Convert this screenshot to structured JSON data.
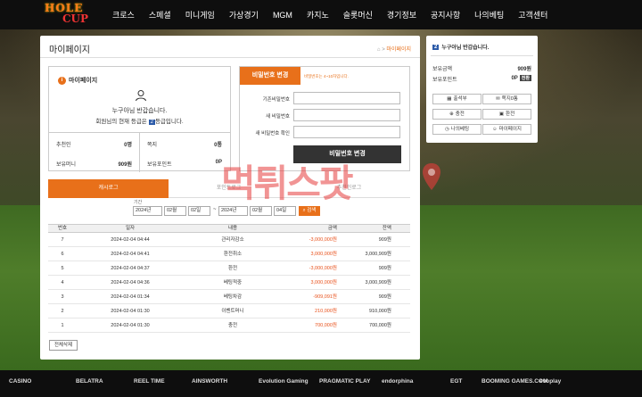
{
  "logo": {
    "line1": "HOLE",
    "line2": "CUP"
  },
  "nav": [
    "크로스",
    "스페셜",
    "미니게임",
    "가상경기",
    "MGM",
    "카지노",
    "슬롯머신",
    "경기정보",
    "공지사항",
    "나의베팅",
    "고객센터"
  ],
  "page": {
    "title": "마이페이지",
    "breadcrumb_sep": ">",
    "breadcrumb_current": "마이페이지"
  },
  "mypage": {
    "header": "마이페이지",
    "greeting": "누구아님 반갑습니다.",
    "level_text": "회원님의 현재 등급은",
    "level": "2",
    "level_suffix": "등급입니다.",
    "stats": [
      {
        "label": "추천인",
        "value": "0명"
      },
      {
        "label": "쪽지",
        "value": "0통"
      },
      {
        "label": "보유머니",
        "value": "909원"
      },
      {
        "label": "보유포인트",
        "value": "0P"
      }
    ]
  },
  "password": {
    "tab": "비밀번호 변경",
    "note": "비밀번호는 4~10자입니다.",
    "fields": [
      "기존비밀번호",
      "새 비밀번호",
      "새 비밀번호 확인"
    ],
    "submit": "비밀번호 변경"
  },
  "tabs": [
    "캐시로그",
    "포인트로그",
    "추천인로그"
  ],
  "search": {
    "label": "기간",
    "from_year": "2024년",
    "from_month": "02월",
    "from_day": "02일",
    "to_sep": "~",
    "to_year": "2024년",
    "to_month": "02월",
    "to_day": "04일",
    "button": "검색"
  },
  "table": {
    "headers": [
      "번호",
      "일자",
      "내용",
      "금액",
      "잔액"
    ],
    "rows": [
      [
        "7",
        "2024-02-04 04:44",
        "관리자감소",
        "-3,000,000원",
        "909원"
      ],
      [
        "6",
        "2024-02-04 04:41",
        "환전취소",
        "3,000,000원",
        "3,000,909원"
      ],
      [
        "5",
        "2024-02-04 04:37",
        "환전",
        "-3,000,000원",
        "909원"
      ],
      [
        "4",
        "2024-02-04 04:36",
        "베팅적중",
        "3,000,000원",
        "3,000,909원"
      ],
      [
        "3",
        "2024-02-04 01:34",
        "베팅차감",
        "-909,091원",
        "909원"
      ],
      [
        "2",
        "2024-02-04 01:30",
        "이벤트머니",
        "210,000원",
        "910,000원"
      ],
      [
        "1",
        "2024-02-04 01:30",
        "충전",
        "700,000원",
        "700,000원"
      ]
    ],
    "delete_button": "전체삭제"
  },
  "side": {
    "level": "2",
    "greeting": "누구아님 반갑습니다.",
    "money_label": "보유금액",
    "money": "909원",
    "point_label": "보유포인트",
    "point": "0P",
    "convert": "전환",
    "buttons": [
      "출석부",
      "쪽지0통",
      "충전",
      "환전",
      "나의베팅",
      "마이페이지"
    ]
  },
  "watermark": "먹튀스팟",
  "footer": [
    "CASINO",
    "BELATRA",
    "REEL TIME",
    "AINSWORTH",
    "Evolution Gaming",
    "PRAGMATIC PLAY",
    "endorphina",
    "EGT",
    "BOOMING GAMES.COM",
    "evoplay"
  ],
  "colors": {
    "accent": "#e8701a",
    "nav_bg": "#0e0e0e",
    "level_badge": "#2b5aa8"
  }
}
